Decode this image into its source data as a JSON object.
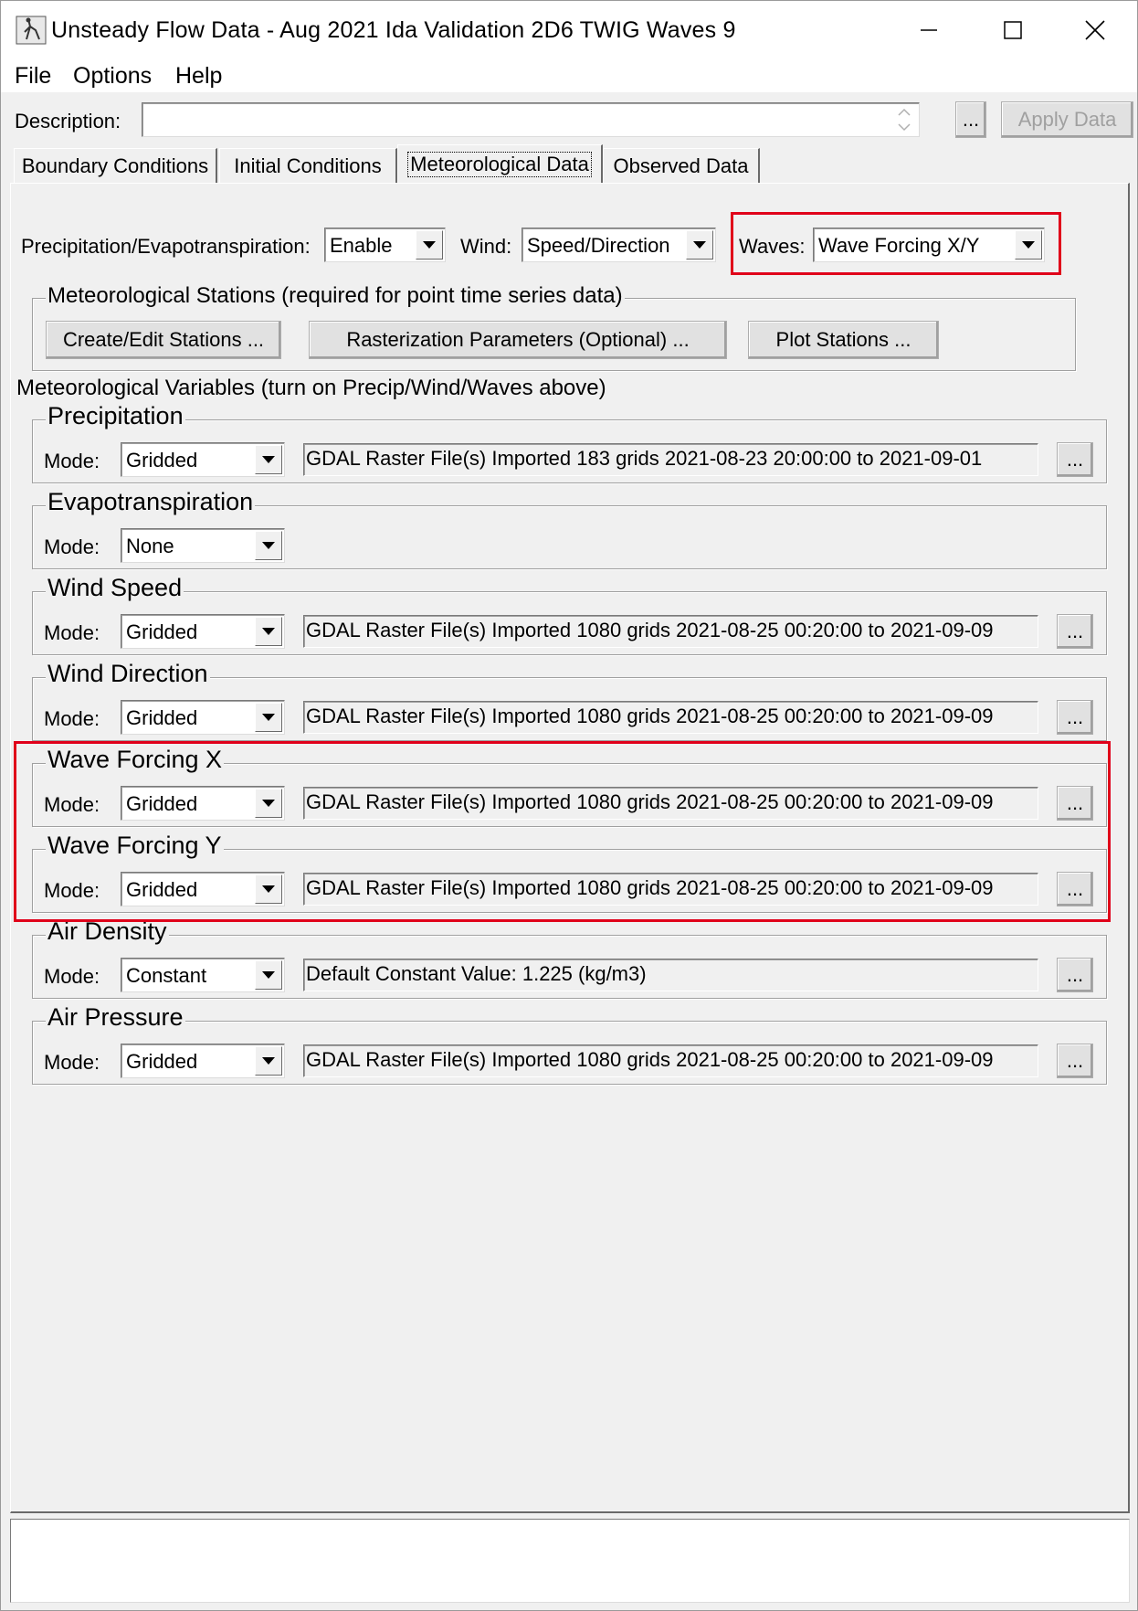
{
  "window": {
    "title": "Unsteady Flow Data - Aug 2021 Ida Validation 2D6 TWIG Waves 9"
  },
  "menu": [
    "File",
    "Options",
    "Help"
  ],
  "description": {
    "label": "Description:",
    "value": "",
    "ellipsis": "...",
    "apply_label": "Apply Data"
  },
  "tabs": [
    {
      "label": "Boundary Conditions"
    },
    {
      "label": "Initial Conditions"
    },
    {
      "label": "Meteorological Data",
      "active": true
    },
    {
      "label": "Observed Data"
    }
  ],
  "met_options": {
    "precip_label": "Precipitation/Evapotranspiration:",
    "precip_value": "Enable",
    "wind_label": "Wind:",
    "wind_value": "Speed/Direction",
    "waves_label": "Waves:",
    "waves_value": "Wave Forcing X/Y"
  },
  "stations": {
    "title": "Meteorological Stations (required for point time series data)",
    "create_label": "Create/Edit Stations ...",
    "raster_label": "Rasterization Parameters (Optional) ...",
    "plot_label": "Plot Stations ..."
  },
  "variables_heading": "Meteorological Variables (turn on Precip/Wind/Waves above)",
  "mode_label": "Mode:",
  "ellipsis": "...",
  "variables": [
    {
      "name": "Precipitation",
      "mode": "Gridded",
      "info": "GDAL Raster File(s) Imported 183 grids 2021-08-23 20:00:00 to 2021-09-01"
    },
    {
      "name": "Evapotranspiration",
      "mode": "None",
      "info": ""
    },
    {
      "name": "Wind Speed",
      "mode": "Gridded",
      "info": "GDAL Raster File(s) Imported 1080 grids 2021-08-25 00:20:00 to 2021-09-09"
    },
    {
      "name": "Wind Direction",
      "mode": "Gridded",
      "info": "GDAL Raster File(s) Imported 1080 grids 2021-08-25 00:20:00 to 2021-09-09"
    },
    {
      "name": "Wave Forcing X",
      "mode": "Gridded",
      "info": "GDAL Raster File(s) Imported 1080 grids 2021-08-25 00:20:00 to 2021-09-09"
    },
    {
      "name": "Wave Forcing Y",
      "mode": "Gridded",
      "info": "GDAL Raster File(s) Imported 1080 grids 2021-08-25 00:20:00 to 2021-09-09"
    },
    {
      "name": "Air Density",
      "mode": "Constant",
      "info": "Default Constant Value: 1.225 (kg/m3)"
    },
    {
      "name": "Air Pressure",
      "mode": "Gridded",
      "info": "GDAL Raster File(s) Imported 1080 grids 2021-08-25 00:20:00 to 2021-09-09"
    }
  ],
  "status_text": "",
  "colors": {
    "highlight": "#e0001a",
    "window_bg": "#f0f0f0"
  }
}
